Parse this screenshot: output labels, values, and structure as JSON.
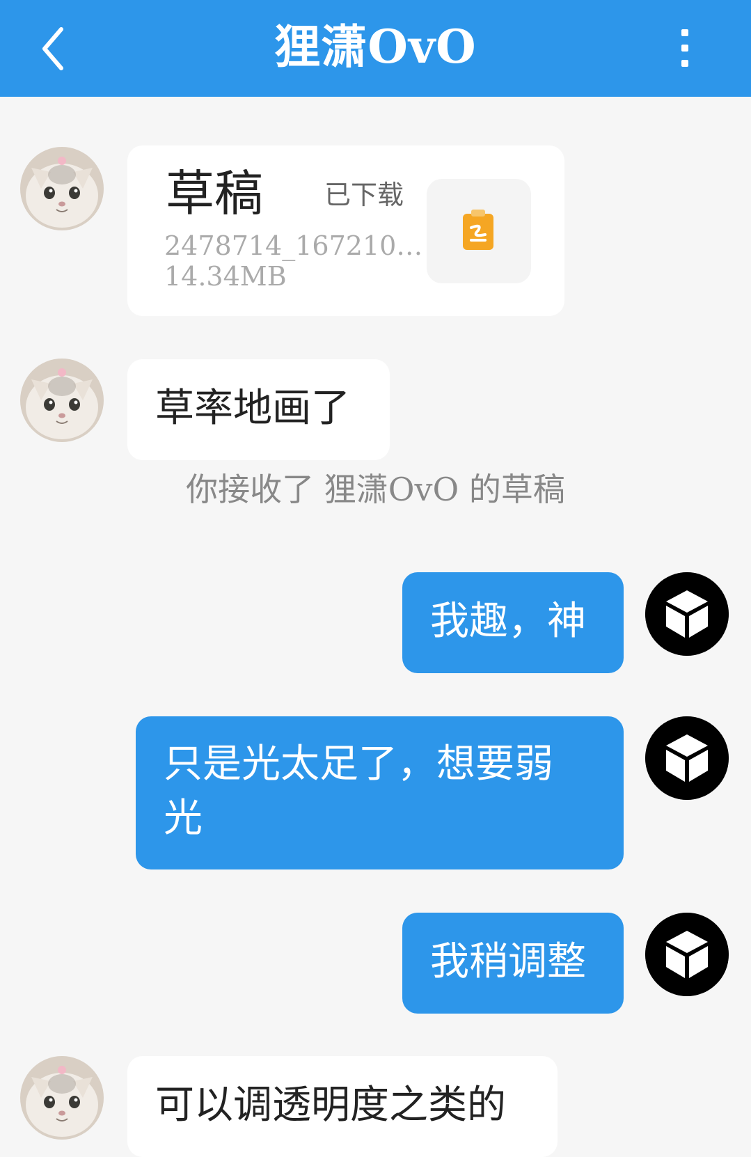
{
  "header": {
    "title": "狸潇OvO",
    "back_icon": "chevron-left-icon",
    "more_icon": "vertical-dots-icon",
    "background": "#2d96ea"
  },
  "messages": {
    "file": {
      "name": "草稿",
      "status": "已下载",
      "id": "2478714_167210…",
      "size": "14.34MB",
      "icon": "drafts-app-icon",
      "icon_color": "#f5a623"
    },
    "msg1": "草率地画了",
    "system": "你接收了 狸潇OvO 的草稿",
    "msg2": "我趣，神",
    "msg3_line1": "只是光太足了，想要弱",
    "msg3_line2": "光",
    "msg4": "我稍调整",
    "msg5": "可以调透明度之类的"
  }
}
